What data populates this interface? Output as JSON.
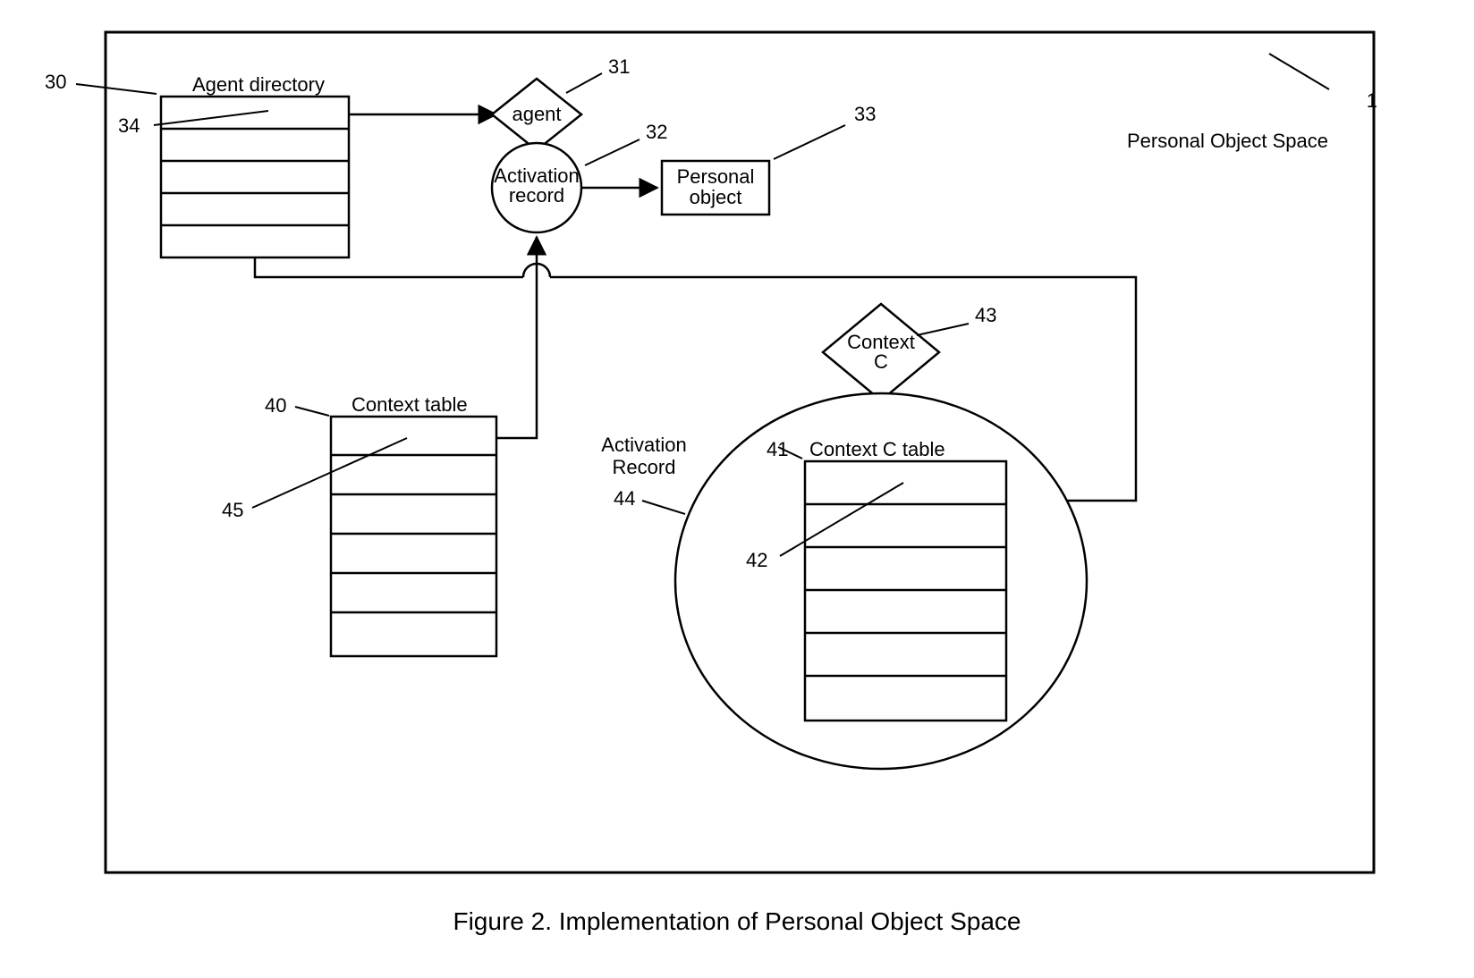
{
  "caption": "Figure 2. Implementation of Personal Object Space",
  "labels": {
    "space": "Personal Object Space",
    "agent_dir": "Agent directory",
    "agent": "agent",
    "act_rec1_l1": "Activation",
    "act_rec1_l2": "record",
    "pobj_l1": "Personal",
    "pobj_l2": "object",
    "ctx_tbl": "Context table",
    "ctx_c_l1": "Context",
    "ctx_c_l2": "C",
    "ctx_c_tbl": "Context C table",
    "act_rec2_l1": "Activation",
    "act_rec2_l2": "Record"
  },
  "refs": {
    "n30": "30",
    "n34": "34",
    "n31": "31",
    "n32": "32",
    "n33": "33",
    "n1": "1",
    "n40": "40",
    "n45": "45",
    "n43": "43",
    "n41": "41",
    "n42": "42",
    "n44": "44"
  }
}
